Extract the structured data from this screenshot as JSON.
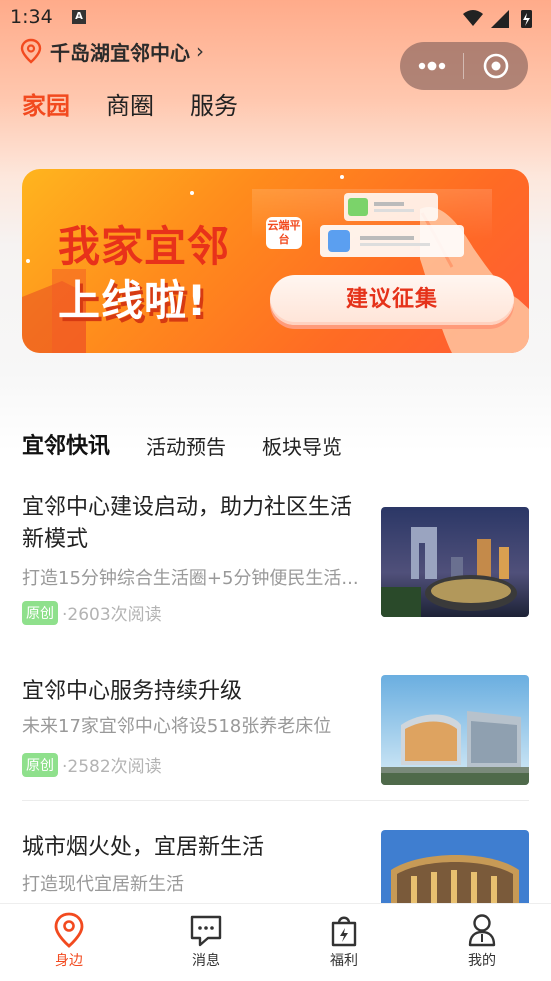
{
  "status_bar": {
    "time": "1:34",
    "a_icon": "A"
  },
  "location": {
    "name": "千岛湖宜邻中心",
    "chevron": "›"
  },
  "top_tabs": [
    {
      "label": "家园",
      "active": true
    },
    {
      "label": "商圈",
      "active": false
    },
    {
      "label": "服务",
      "active": false
    }
  ],
  "banner": {
    "title_line1": "我家宜邻",
    "title_line2": "上线啦!",
    "tag": "云端平台",
    "button_label": "建议征集"
  },
  "content_tabs": [
    {
      "label": "宜邻快讯",
      "active": true
    },
    {
      "label": "活动预告",
      "active": false
    },
    {
      "label": "板块导览",
      "active": false
    }
  ],
  "news": [
    {
      "title": "宜邻中心建设启动，助力社区生活新模式",
      "subtitle": "打造15分钟综合生活圈+5分钟便民生活...",
      "badge": "原创",
      "reads": "·2603次阅读"
    },
    {
      "title": "宜邻中心服务持续升级",
      "subtitle": "未来17家宜邻中心将设518张养老床位",
      "badge": "原创",
      "reads": "·2582次阅读"
    },
    {
      "title": " 城市烟火处，宜居新生活",
      "subtitle": "打造现代宜居新生活"
    }
  ],
  "bottom_nav": [
    {
      "label": "身边",
      "icon": "location-pin-icon",
      "active": true
    },
    {
      "label": "消息",
      "icon": "message-icon",
      "active": false
    },
    {
      "label": "福利",
      "icon": "gift-bag-icon",
      "active": false
    },
    {
      "label": "我的",
      "icon": "user-icon",
      "active": false
    }
  ],
  "colors": {
    "accent": "#f24a1f",
    "badge": "#8fe08c"
  }
}
